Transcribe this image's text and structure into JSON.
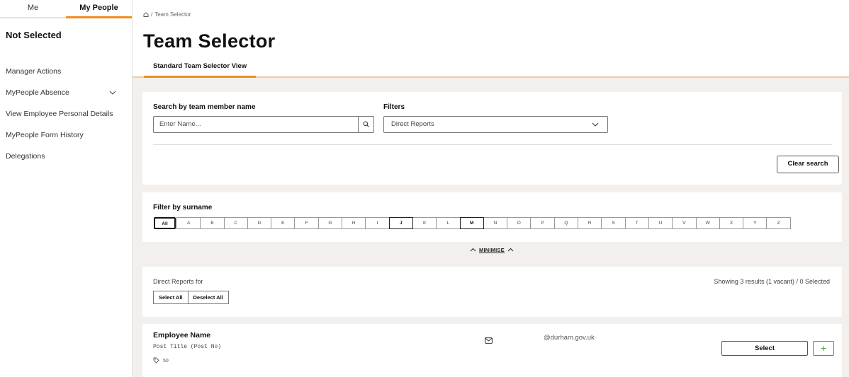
{
  "sidebar": {
    "tabs": [
      {
        "label": "Me"
      },
      {
        "label": "My People"
      }
    ],
    "status": "Not Selected",
    "items": [
      {
        "label": "Manager Actions"
      },
      {
        "label": "MyPeople Absence"
      },
      {
        "label": "View Employee Personal Details"
      },
      {
        "label": "MyPeople Form History"
      },
      {
        "label": "Delegations"
      }
    ]
  },
  "breadcrumb": {
    "icon": "home-icon",
    "separator": "/",
    "current": "Team Selector"
  },
  "page": {
    "title": "Team Selector"
  },
  "tabs": [
    {
      "label": "Standard Team Selector View"
    }
  ],
  "search": {
    "name_label": "Search by team member name",
    "name_placeholder": "Enter Name...",
    "filters_label": "Filters",
    "filter_value": "Direct Reports",
    "clear_label": "Clear search"
  },
  "surname_filter": {
    "label": "Filter by surname",
    "all_label": "All",
    "letters": [
      "A",
      "B",
      "C",
      "D",
      "E",
      "F",
      "G",
      "H",
      "I",
      "J",
      "K",
      "L",
      "M",
      "N",
      "O",
      "P",
      "Q",
      "R",
      "S",
      "T",
      "U",
      "V",
      "W",
      "X",
      "Y",
      "Z"
    ],
    "highlighted": [
      "J",
      "M"
    ]
  },
  "minimise_label": "MINIMISE",
  "reports": {
    "label": "Direct Reports for",
    "count_text": "Showing 3 results (1 vacant) / 0 Selected",
    "select_all": "Select All",
    "deselect_all": "Deselect All"
  },
  "employee": {
    "name": "Employee Name",
    "post": "Post Title (Post No)",
    "tag": "50",
    "email": "@durham.gov.uk",
    "select_label": "Select",
    "plus_label": "+"
  },
  "colors": {
    "accent": "#f28c1e",
    "background": "#f2efec",
    "success": "#4c9a3b"
  }
}
